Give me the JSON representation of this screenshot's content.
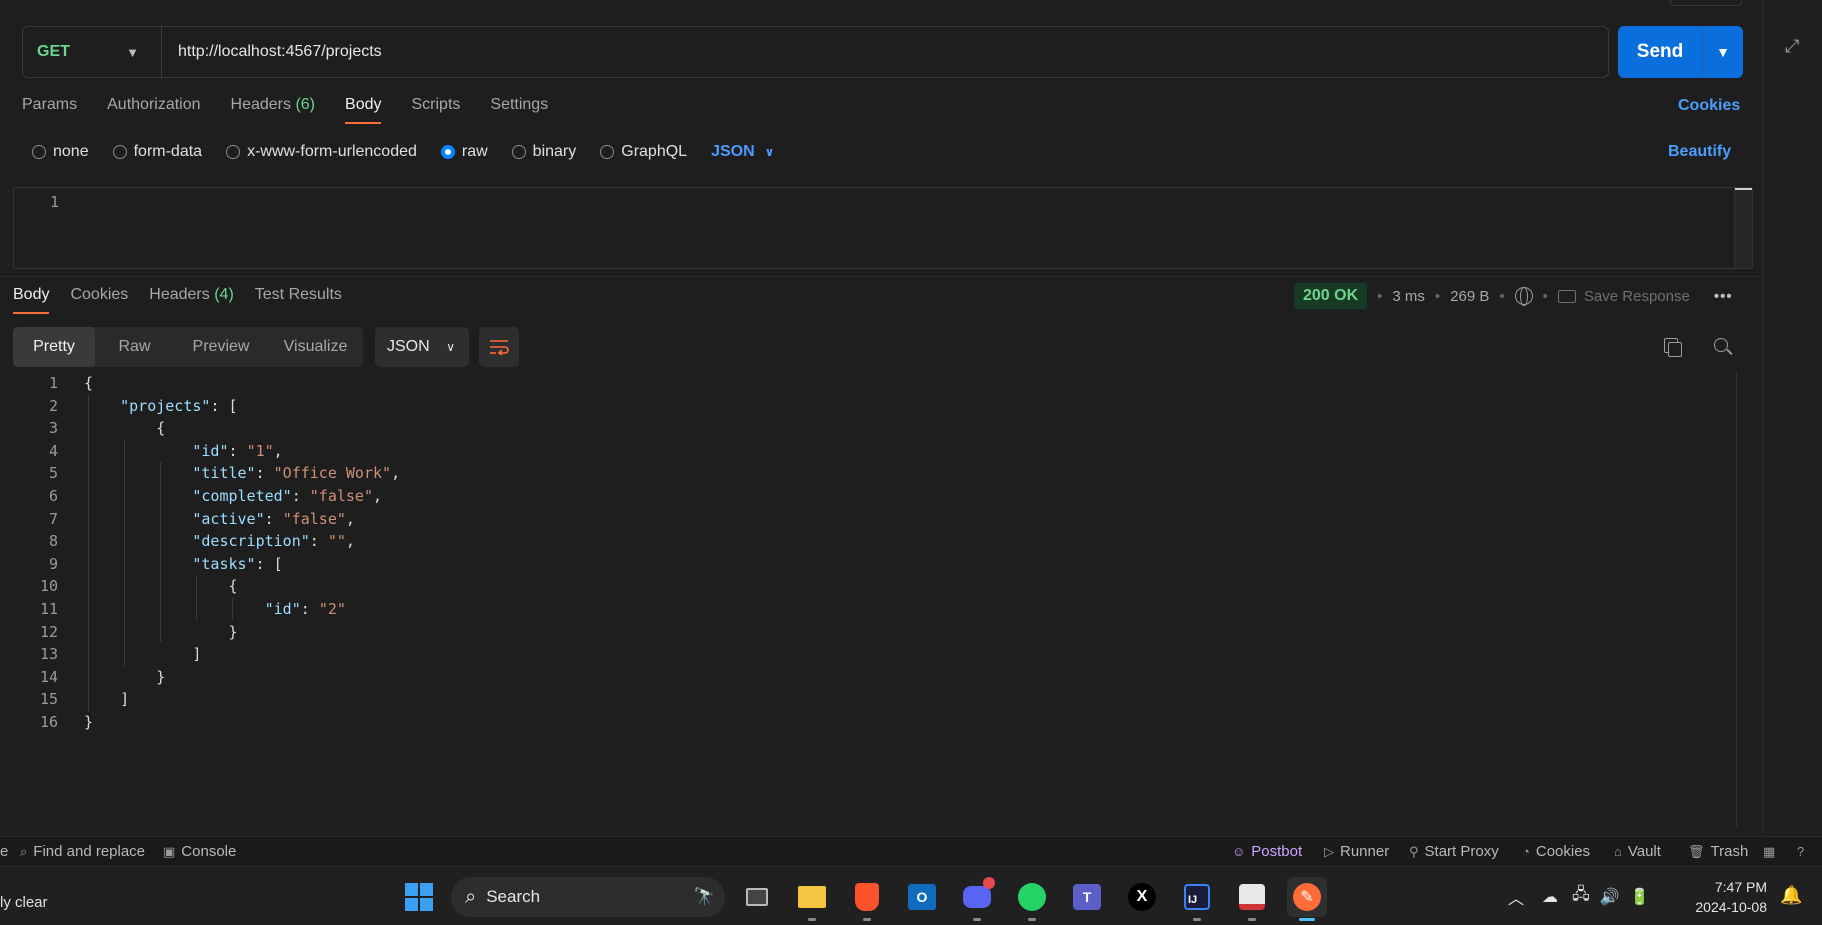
{
  "request": {
    "method": "GET",
    "url": "http://localhost:4567/projects",
    "send_label": "Send",
    "tabs": [
      {
        "label": "Params",
        "count": ""
      },
      {
        "label": "Authorization",
        "count": ""
      },
      {
        "label": "Headers",
        "count": "(6)"
      },
      {
        "label": "Body",
        "count": ""
      },
      {
        "label": "Scripts",
        "count": ""
      },
      {
        "label": "Settings",
        "count": ""
      }
    ],
    "cookies_link": "Cookies",
    "body_types": [
      "none",
      "form-data",
      "x-www-form-urlencoded",
      "raw",
      "binary",
      "GraphQL"
    ],
    "selected_body_type": "raw",
    "body_format": "JSON",
    "beautify_label": "Beautify",
    "editor_line": "1"
  },
  "response": {
    "tabs": [
      {
        "label": "Body",
        "count": ""
      },
      {
        "label": "Cookies",
        "count": ""
      },
      {
        "label": "Headers",
        "count": "(4)"
      },
      {
        "label": "Test Results",
        "count": ""
      }
    ],
    "status": "200 OK",
    "time": "3 ms",
    "size": "269 B",
    "save_response": "Save Response",
    "view_modes": [
      "Pretty",
      "Raw",
      "Preview",
      "Visualize"
    ],
    "format": "JSON",
    "code_lines": [
      {
        "n": "1",
        "text": "{"
      },
      {
        "n": "2",
        "text": "    \"projects\": ["
      },
      {
        "n": "3",
        "text": "        {"
      },
      {
        "n": "4",
        "text": "            \"id\": \"1\","
      },
      {
        "n": "5",
        "text": "            \"title\": \"Office Work\","
      },
      {
        "n": "6",
        "text": "            \"completed\": \"false\","
      },
      {
        "n": "7",
        "text": "            \"active\": \"false\","
      },
      {
        "n": "8",
        "text": "            \"description\": \"\","
      },
      {
        "n": "9",
        "text": "            \"tasks\": ["
      },
      {
        "n": "10",
        "text": "                {"
      },
      {
        "n": "11",
        "text": "                    \"id\": \"2\""
      },
      {
        "n": "12",
        "text": "                }"
      },
      {
        "n": "13",
        "text": "            ]"
      },
      {
        "n": "14",
        "text": "        }"
      },
      {
        "n": "15",
        "text": "    ]"
      },
      {
        "n": "16",
        "text": "}"
      }
    ]
  },
  "status_bar": {
    "left_cut": "e",
    "find_replace": "Find and replace",
    "console": "Console",
    "postbot": "Postbot",
    "runner": "Runner",
    "start_proxy": "Start Proxy",
    "cookies": "Cookies",
    "vault": "Vault",
    "trash": "Trash"
  },
  "taskbar": {
    "left_text": "ly clear",
    "search_label": "Search",
    "time": "7:47 PM",
    "date": "2024-10-08",
    "apps": [
      "start-icon",
      "task-view-icon",
      "file-explorer-icon",
      "brave-browser-icon",
      "outlook-icon",
      "discord-icon",
      "whatsapp-icon",
      "teams-icon",
      "x-icon",
      "intellij-icon",
      "snipping-tool-icon",
      "postman-icon"
    ]
  },
  "colors": {
    "accent_orange": "#ff6c37",
    "send_blue": "#0a6fdc",
    "method_green": "#6bd58e",
    "link_blue": "#4a9dff"
  }
}
